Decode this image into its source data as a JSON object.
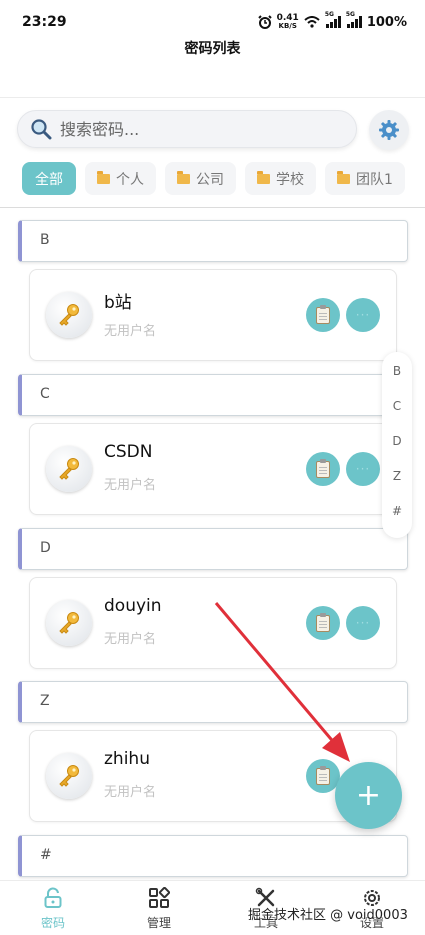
{
  "status_bar": {
    "time": "23:29",
    "net_speed_value": "0.41",
    "net_speed_unit": "KB/S",
    "sim1": "5G",
    "sim2": "5G",
    "battery": "100%"
  },
  "header": {
    "title": "密码列表"
  },
  "search": {
    "placeholder": "搜索密码..."
  },
  "tabs": [
    {
      "label": "全部",
      "active": true
    },
    {
      "label": "个人"
    },
    {
      "label": "公司"
    },
    {
      "label": "学校"
    },
    {
      "label": "团队1"
    }
  ],
  "sections": [
    {
      "letter": "B",
      "entries": [
        {
          "name": "b站",
          "username": "无用户名"
        }
      ]
    },
    {
      "letter": "C",
      "entries": [
        {
          "name": "CSDN",
          "username": "无用户名"
        }
      ]
    },
    {
      "letter": "D",
      "entries": [
        {
          "name": "douyin",
          "username": "无用户名"
        }
      ]
    },
    {
      "letter": "Z",
      "entries": [
        {
          "name": "zhihu",
          "username": "无用户名"
        }
      ]
    },
    {
      "letter": "#",
      "entries": []
    }
  ],
  "index_bar": [
    "B",
    "C",
    "D",
    "Z",
    "#"
  ],
  "more_label": "···",
  "fab_label": "+",
  "bottom_nav": [
    {
      "label": "密码",
      "active": true
    },
    {
      "label": "管理"
    },
    {
      "label": "工具"
    },
    {
      "label": "设置"
    }
  ],
  "watermark": "掘金技术社区 @ void0003",
  "colors": {
    "accent": "#6cc4c9",
    "section_bar": "#8f94d3",
    "arrow": "#e0303a"
  }
}
